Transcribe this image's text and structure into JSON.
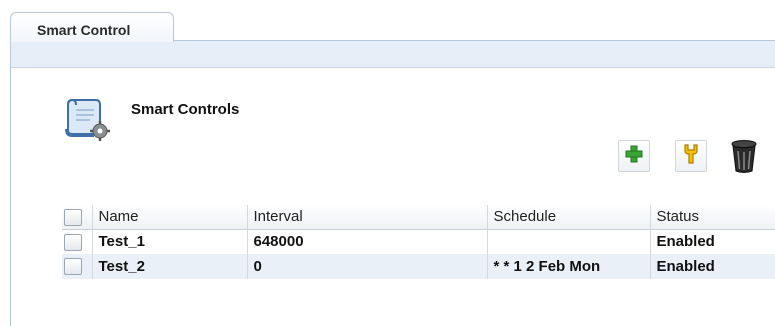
{
  "tab": {
    "label": "Smart Control"
  },
  "section": {
    "title": "Smart Controls",
    "icon": "scroll-settings-icon"
  },
  "toolbar": {
    "add_icon": "plus-icon",
    "edit_icon": "wrench-icon",
    "delete_icon": "trash-icon",
    "colors": {
      "add": "#3aa534",
      "edit": "#e6a600",
      "delete": "#222222"
    }
  },
  "table": {
    "columns": [
      "Name",
      "Interval",
      "Schedule",
      "Status"
    ],
    "rows": [
      {
        "name": "Test_1",
        "interval": "648000",
        "schedule": "",
        "status": "Enabled"
      },
      {
        "name": "Test_2",
        "interval": "0",
        "schedule": "* * 1 2 Feb Mon",
        "status": "Enabled"
      }
    ]
  }
}
